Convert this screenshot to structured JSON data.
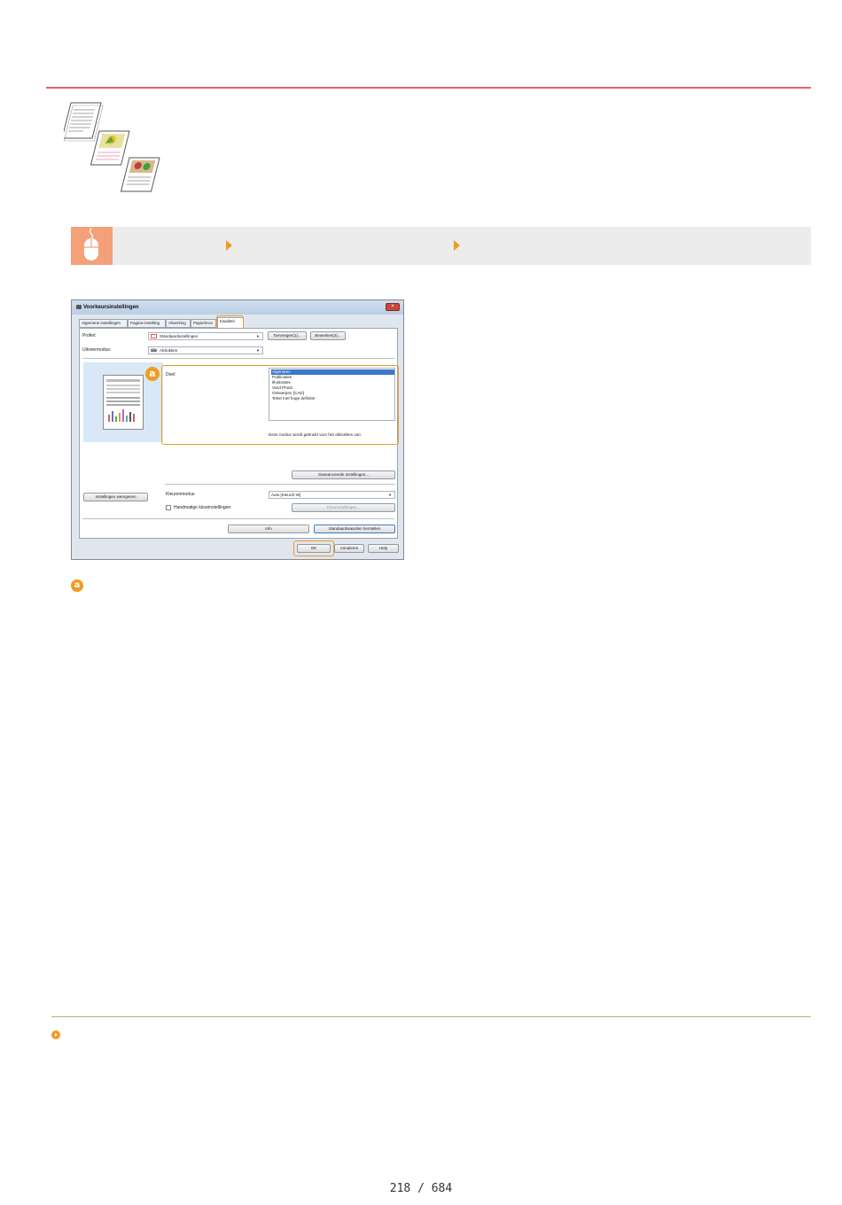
{
  "dialog": {
    "title": "Voorkeursinstellingen",
    "close_glyph": "×",
    "tabs": [
      "Algemene instellingen",
      "Pagina-instelling",
      "Afwerking",
      "Papierbron",
      "Kwaliteit"
    ],
    "active_tab": "Kwaliteit",
    "profile_label": "Profiel:",
    "profile_value": "Standaardinstellingen",
    "add_button": "Toevoegen(1)...",
    "edit_button": "Bewerken(2)...",
    "output_label": "Uitvoermodus:",
    "output_value": "Afdrukken",
    "marker_letter": "a",
    "doel_label": "Doel:",
    "doel_options": [
      "Algemeen",
      "Publicaties",
      "Illustraties",
      "Vivid Photo",
      "Ontwerpen [CAD]",
      "Tekst met hoge definitie"
    ],
    "doel_selected": "Algemeen",
    "description": "Deze modus wordt gebruikt voor het afdrukken van",
    "advanced_button": "Geavanceerde instellingen...",
    "view_settings_button": "Instellingen weergeven",
    "color_mode_label": "Kleurenmodus:",
    "color_mode_value": "Auto [Kleur/Z-W]",
    "manual_color_label": "Handmatige kleurinstellingen",
    "color_settings_button": "Kleurinstellingen...",
    "info_button": "Info",
    "restore_button": "Standaardwaarden herstellen",
    "ok_button": "OK",
    "cancel_button": "Annuleren",
    "help_button": "Help"
  },
  "callout": {
    "marker_letter": "a"
  },
  "footer": {
    "page_number": "218 / 684"
  },
  "colors": {
    "accent": "#f29b21",
    "top_rule": "#e06070",
    "bottom_rule": "#9cc07a",
    "mouse_icon_bg": "#f4a07a",
    "selection": "#3a78c8"
  }
}
